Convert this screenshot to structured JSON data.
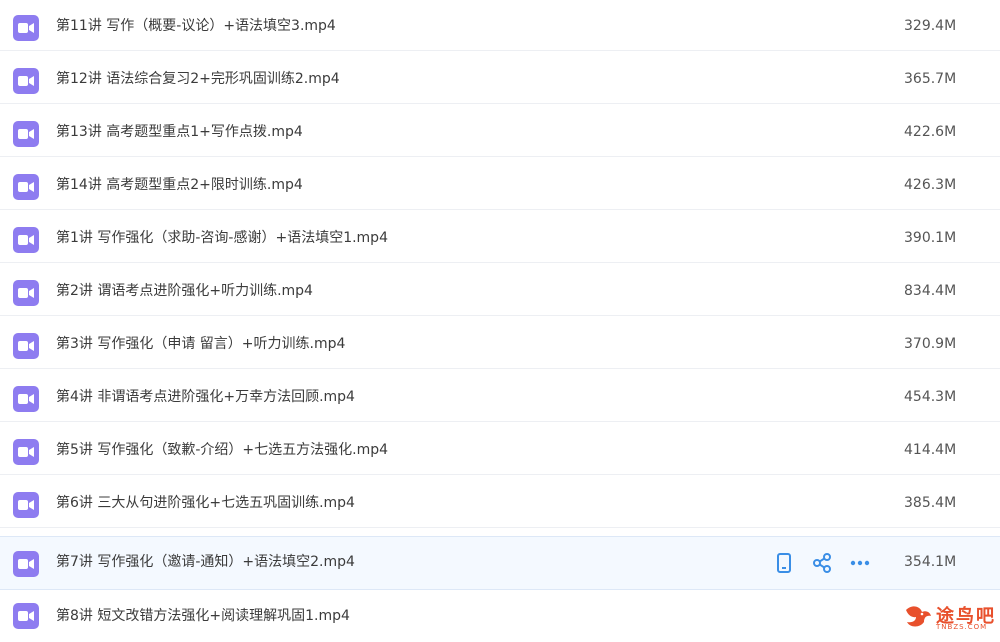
{
  "files": [
    {
      "name": "第11讲 写作（概要-议论）+语法填空3.mp4",
      "size": "329.4M"
    },
    {
      "name": "第12讲 语法综合复习2+完形巩固训练2.mp4",
      "size": "365.7M"
    },
    {
      "name": "第13讲 高考题型重点1+写作点拨.mp4",
      "size": "422.6M"
    },
    {
      "name": "第14讲 高考题型重点2+限时训练.mp4",
      "size": "426.3M"
    },
    {
      "name": "第1讲 写作强化（求助-咨询-感谢）+语法填空1.mp4",
      "size": "390.1M"
    },
    {
      "name": "第2讲 谓语考点进阶强化+听力训练.mp4",
      "size": "834.4M"
    },
    {
      "name": "第3讲 写作强化（申请 留言）+听力训练.mp4",
      "size": "370.9M"
    },
    {
      "name": "第4讲 非谓语考点进阶强化+万幸方法回顾.mp4",
      "size": "454.3M"
    },
    {
      "name": "第5讲 写作强化（致歉-介绍）+七选五方法强化.mp4",
      "size": "414.4M"
    },
    {
      "name": "第6讲 三大从句进阶强化+七选五巩固训练.mp4",
      "size": "385.4M"
    },
    {
      "name": "第7讲 写作强化（邀请-通知）+语法填空2.mp4",
      "size": "354.1M"
    },
    {
      "name": "第8讲 短文改错方法强化+阅读理解巩固1.mp4",
      "size": ""
    }
  ],
  "hovered_index": 10,
  "row_actions": [
    "phone-icon",
    "share-icon",
    "more-icon"
  ],
  "watermark": {
    "text": "途鸟吧",
    "sub": "TNBZS.COM"
  },
  "colors": {
    "icon_bg": "#8e7cf0",
    "action": "#3a8ee6",
    "watermark": "#e8502c"
  }
}
